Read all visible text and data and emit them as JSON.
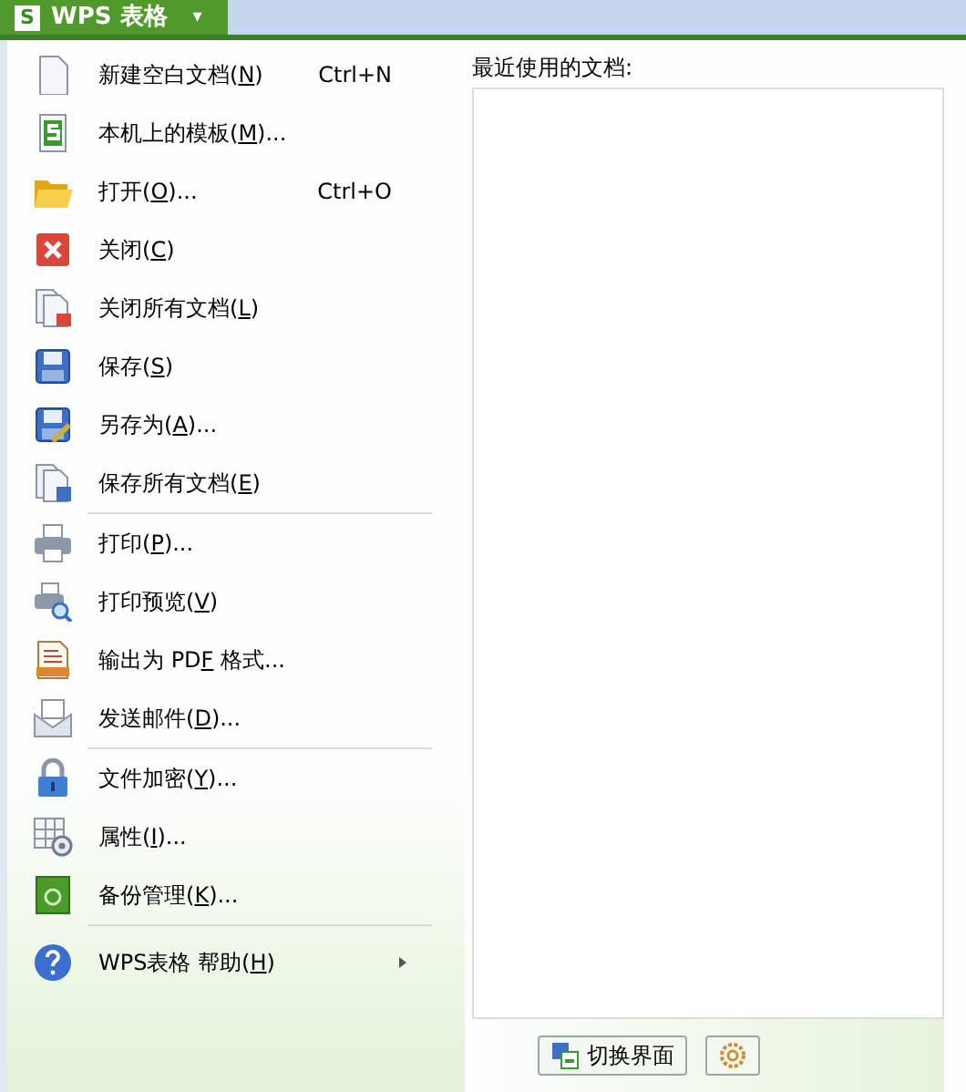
{
  "app_button": {
    "logo": "S",
    "title": "WPS 表格",
    "caret": "▾"
  },
  "menu": {
    "groups": [
      [
        {
          "kind": "new",
          "before": "新建空白文档(",
          "key": "N",
          "after": ")",
          "shortcut": "Ctrl+N"
        },
        {
          "kind": "template",
          "before": "本机上的模板(",
          "key": "M",
          "after": ")..."
        },
        {
          "kind": "open",
          "before": "打开(",
          "key": "O",
          "after": ")...",
          "shortcut": "Ctrl+O"
        },
        {
          "kind": "close",
          "before": "关闭(",
          "key": "C",
          "after": ")"
        },
        {
          "kind": "closeall",
          "before": "关闭所有文档(",
          "key": "L",
          "after": ")"
        },
        {
          "kind": "save",
          "before": "保存(",
          "key": "S",
          "after": ")"
        },
        {
          "kind": "saveas",
          "before": "另存为(",
          "key": "A",
          "after": ")..."
        },
        {
          "kind": "saveall",
          "before": "保存所有文档(",
          "key": "E",
          "after": ")"
        }
      ],
      [
        {
          "kind": "print",
          "before": "打印(",
          "key": "P",
          "after": ")..."
        },
        {
          "kind": "preview",
          "before": "打印预览(",
          "key": "V",
          "after": ")"
        },
        {
          "kind": "pdf",
          "before": "输出为 PD",
          "key": "F",
          "after": " 格式..."
        },
        {
          "kind": "mail",
          "before": "发送邮件(",
          "key": "D",
          "after": ")..."
        }
      ],
      [
        {
          "kind": "lock",
          "before": "文件加密(",
          "key": "Y",
          "after": ")..."
        },
        {
          "kind": "props",
          "before": "属性(",
          "key": "I",
          "after": ")..."
        },
        {
          "kind": "backup",
          "before": "备份管理(",
          "key": "K",
          "after": ")..."
        }
      ],
      [
        {
          "kind": "help",
          "before": "WPS表格 帮助(",
          "key": "H",
          "after": ")",
          "submenu": true
        }
      ]
    ]
  },
  "recent": {
    "label": "最近使用的文档:"
  },
  "footer": {
    "buttons": [
      {
        "kind": "switch",
        "label": "切换界面"
      },
      {
        "kind": "gear"
      }
    ]
  }
}
